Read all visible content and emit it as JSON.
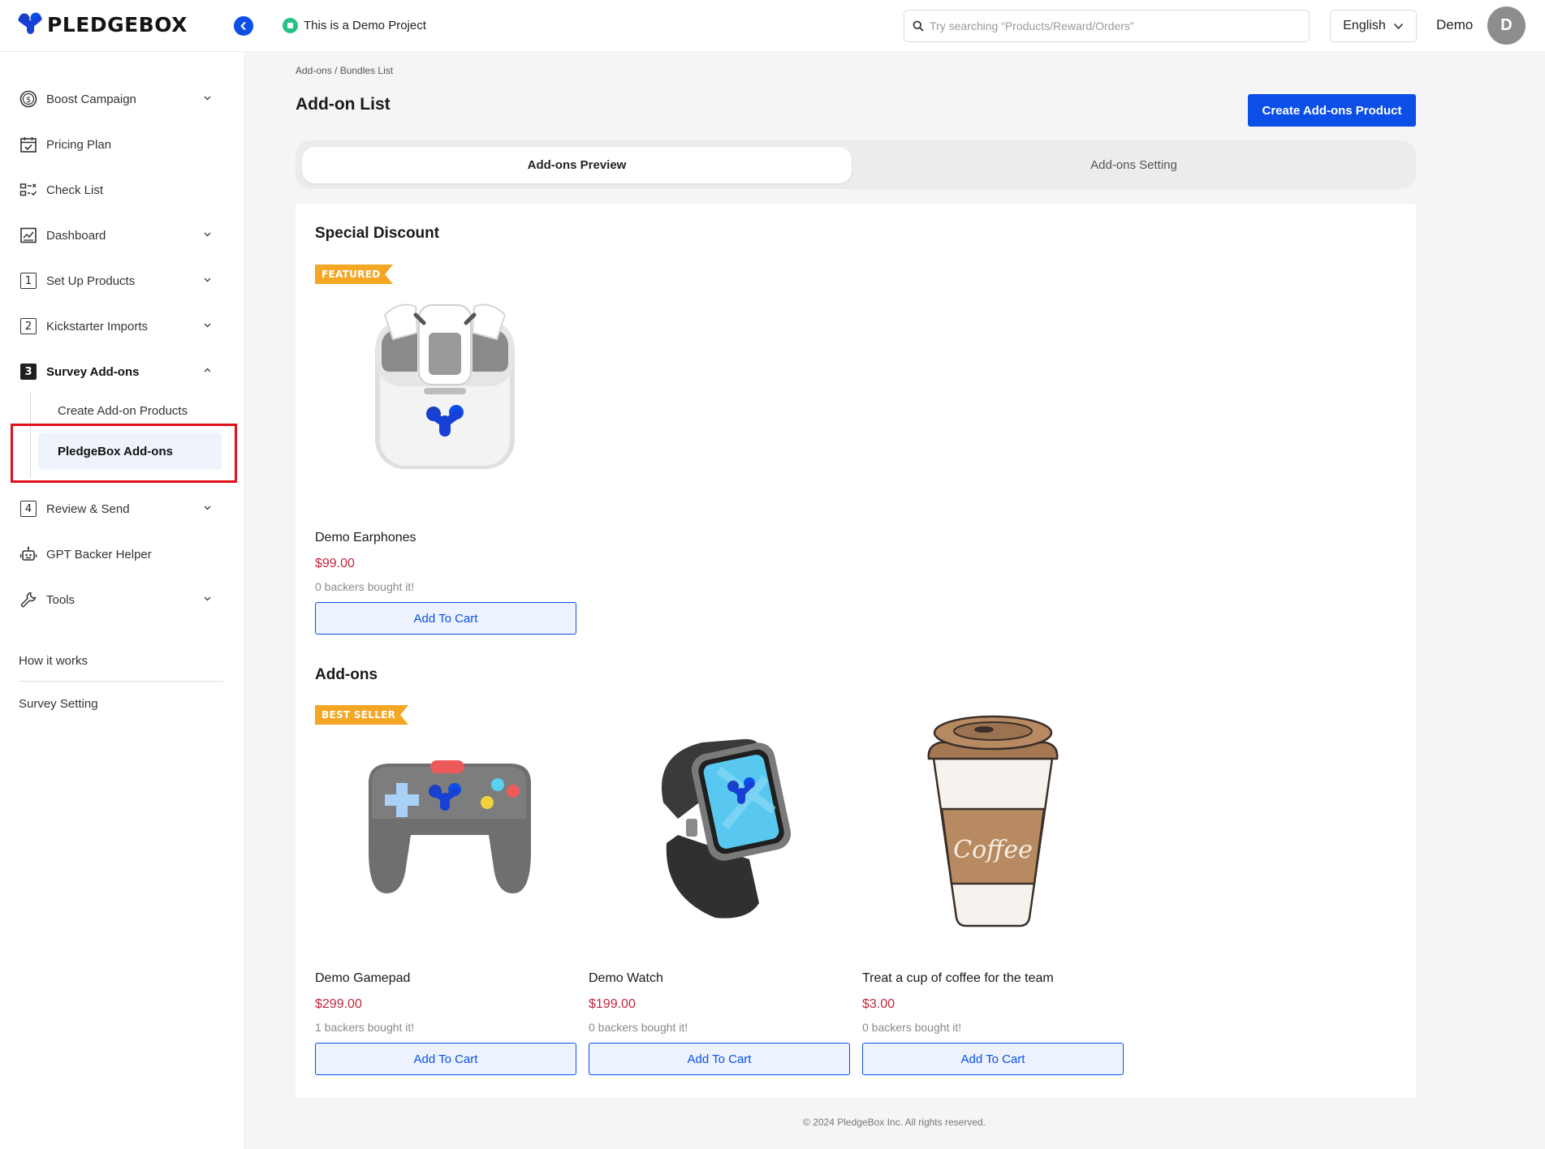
{
  "app": {
    "brand": "PLEDGEBOX",
    "demo_label": "This is a Demo Project",
    "search_placeholder": "Try searching “Products/Reward/Orders”",
    "language": "English",
    "user_name": "Demo",
    "avatar_initial": "D",
    "colors": {
      "primary": "#0b4fe6",
      "price": "#c0273c",
      "badge": "#f5a623",
      "highlight": "#e0101a"
    }
  },
  "sidebar": {
    "items": [
      {
        "label": "Boost Campaign",
        "icon": "dollar-circle-icon",
        "expandable": true
      },
      {
        "label": "Pricing Plan",
        "icon": "calendar-check-icon",
        "expandable": false
      },
      {
        "label": "Check List",
        "icon": "checklist-icon",
        "expandable": false
      },
      {
        "label": "Dashboard",
        "icon": "chart-icon",
        "expandable": true
      },
      {
        "label": "Set Up Products",
        "icon": "number-1-icon",
        "number": "1",
        "expandable": true
      },
      {
        "label": "Kickstarter Imports",
        "icon": "number-2-icon",
        "number": "2",
        "expandable": true
      },
      {
        "label": "Survey Add-ons",
        "icon": "number-3-icon",
        "number": "3",
        "expandable": true,
        "expanded": true
      },
      {
        "label": "Review & Send",
        "icon": "number-4-icon",
        "number": "4",
        "expandable": true
      },
      {
        "label": "GPT Backer Helper",
        "icon": "robot-icon",
        "expandable": false
      },
      {
        "label": "Tools",
        "icon": "wrench-icon",
        "expandable": true
      }
    ],
    "subitems": [
      {
        "label": "Create Add-on Products",
        "active": false
      },
      {
        "label": "PledgeBox Add-ons",
        "active": true
      }
    ],
    "links": [
      "How it works",
      "Survey Setting"
    ]
  },
  "main": {
    "breadcrumb": "Add-ons / Bundles List",
    "title": "Add-on List",
    "create_button": "Create Add-ons Product",
    "tabs": [
      {
        "label": "Add-ons Preview",
        "active": true
      },
      {
        "label": "Add-ons Setting",
        "active": false
      }
    ],
    "sections": [
      {
        "title": "Special Discount",
        "badge": "FEATURED",
        "products": [
          {
            "name": "Demo Earphones",
            "price": "$99.00",
            "bought": "0 backers bought it!",
            "button": "Add To Cart",
            "image": "earphones-image"
          }
        ]
      },
      {
        "title": "Add-ons",
        "badge": "BEST SELLER",
        "products": [
          {
            "name": "Demo Gamepad",
            "price": "$299.00",
            "bought": "1 backers bought it!",
            "button": "Add To Cart",
            "image": "gamepad-image"
          },
          {
            "name": "Demo Watch",
            "price": "$199.00",
            "bought": "0 backers bought it!",
            "button": "Add To Cart",
            "image": "watch-image"
          },
          {
            "name": "Treat a cup of coffee for the team",
            "price": "$3.00",
            "bought": "0 backers bought it!",
            "button": "Add To Cart",
            "image": "coffee-cup-image",
            "image_text": "Coffee"
          }
        ]
      }
    ],
    "footer": "© 2024 PledgeBox Inc. All rights reserved."
  }
}
